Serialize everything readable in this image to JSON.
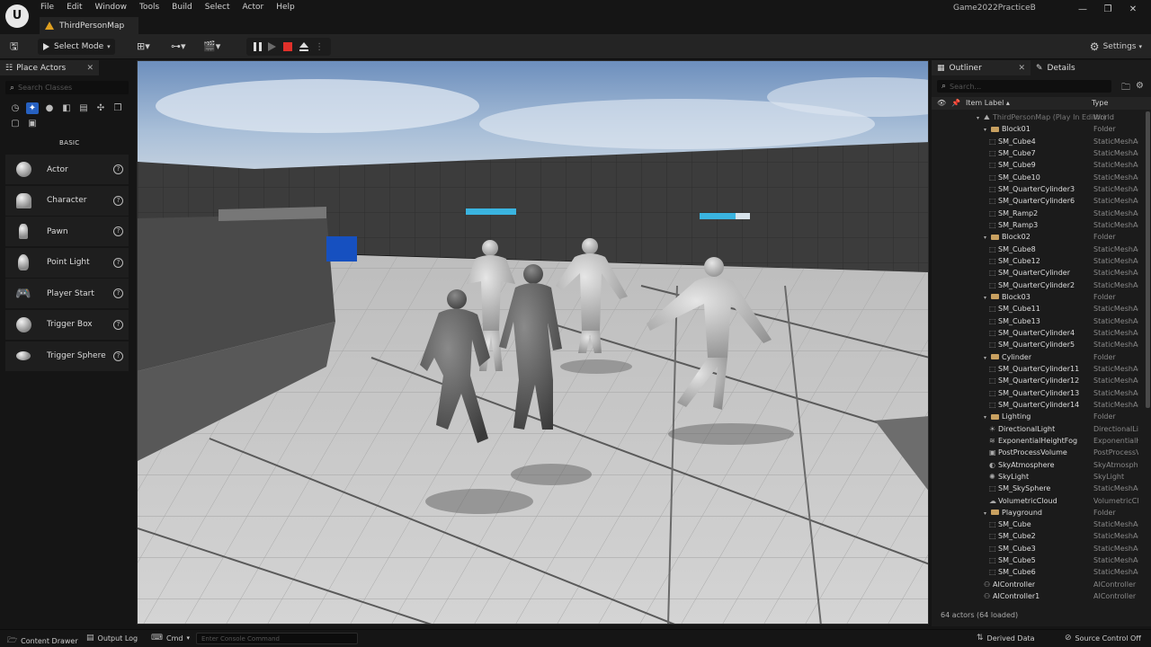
{
  "menu": [
    "File",
    "Edit",
    "Window",
    "Tools",
    "Build",
    "Select",
    "Actor",
    "Help"
  ],
  "document_tab": "ThirdPersonMap",
  "project_name": "Game2022PracticeB",
  "window_controls": [
    "—",
    "❐",
    "✕"
  ],
  "toolbar": {
    "select_mode": "Select Mode",
    "settings": "Settings"
  },
  "place_actors": {
    "tab_label": "Place Actors",
    "search_placeholder": "Search Classes",
    "category_label": "BASIC",
    "items": [
      {
        "label": "Actor"
      },
      {
        "label": "Character"
      },
      {
        "label": "Pawn"
      },
      {
        "label": "Point Light"
      },
      {
        "label": "Player Start"
      },
      {
        "label": "Trigger Box"
      },
      {
        "label": "Trigger Sphere"
      }
    ]
  },
  "outliner": {
    "tab_label": "Outliner",
    "details_tab": "Details",
    "search_placeholder": "Search...",
    "col_label": "Item Label ▴",
    "col_type": "Type",
    "footer": "64 actors (64 loaded)",
    "rows": [
      {
        "name": "ThirdPersonMap (Play In Editor)",
        "type": "World",
        "level": 0,
        "kind": "root"
      },
      {
        "name": "Block01",
        "type": "Folder",
        "level": 1,
        "kind": "folder"
      },
      {
        "name": "SM_Cube4",
        "type": "StaticMeshActor",
        "level": 2,
        "kind": "mesh"
      },
      {
        "name": "SM_Cube7",
        "type": "StaticMeshActor",
        "level": 2,
        "kind": "mesh"
      },
      {
        "name": "SM_Cube9",
        "type": "StaticMeshActor",
        "level": 2,
        "kind": "mesh"
      },
      {
        "name": "SM_Cube10",
        "type": "StaticMeshActor",
        "level": 2,
        "kind": "mesh"
      },
      {
        "name": "SM_QuarterCylinder3",
        "type": "StaticMeshActor",
        "level": 2,
        "kind": "mesh"
      },
      {
        "name": "SM_QuarterCylinder6",
        "type": "StaticMeshActor",
        "level": 2,
        "kind": "mesh"
      },
      {
        "name": "SM_Ramp2",
        "type": "StaticMeshActor",
        "level": 2,
        "kind": "mesh"
      },
      {
        "name": "SM_Ramp3",
        "type": "StaticMeshActor",
        "level": 2,
        "kind": "mesh"
      },
      {
        "name": "Block02",
        "type": "Folder",
        "level": 1,
        "kind": "folder"
      },
      {
        "name": "SM_Cube8",
        "type": "StaticMeshActor",
        "level": 2,
        "kind": "mesh"
      },
      {
        "name": "SM_Cube12",
        "type": "StaticMeshActor",
        "level": 2,
        "kind": "mesh"
      },
      {
        "name": "SM_QuarterCylinder",
        "type": "StaticMeshActor",
        "level": 2,
        "kind": "mesh"
      },
      {
        "name": "SM_QuarterCylinder2",
        "type": "StaticMeshActor",
        "level": 2,
        "kind": "mesh"
      },
      {
        "name": "Block03",
        "type": "Folder",
        "level": 1,
        "kind": "folder"
      },
      {
        "name": "SM_Cube11",
        "type": "StaticMeshActor",
        "level": 2,
        "kind": "mesh"
      },
      {
        "name": "SM_Cube13",
        "type": "StaticMeshActor",
        "level": 2,
        "kind": "mesh"
      },
      {
        "name": "SM_QuarterCylinder4",
        "type": "StaticMeshActor",
        "level": 2,
        "kind": "mesh"
      },
      {
        "name": "SM_QuarterCylinder5",
        "type": "StaticMeshActor",
        "level": 2,
        "kind": "mesh"
      },
      {
        "name": "Cylinder",
        "type": "Folder",
        "level": 1,
        "kind": "folder"
      },
      {
        "name": "SM_QuarterCylinder11",
        "type": "StaticMeshActor",
        "level": 2,
        "kind": "mesh"
      },
      {
        "name": "SM_QuarterCylinder12",
        "type": "StaticMeshActor",
        "level": 2,
        "kind": "mesh"
      },
      {
        "name": "SM_QuarterCylinder13",
        "type": "StaticMeshActor",
        "level": 2,
        "kind": "mesh"
      },
      {
        "name": "SM_QuarterCylinder14",
        "type": "StaticMeshActor",
        "level": 2,
        "kind": "mesh"
      },
      {
        "name": "Lighting",
        "type": "Folder",
        "level": 1,
        "kind": "folder"
      },
      {
        "name": "DirectionalLight",
        "type": "DirectionalLight",
        "level": 2,
        "kind": "light"
      },
      {
        "name": "ExponentialHeightFog",
        "type": "ExponentialHeightFog",
        "level": 2,
        "kind": "fog"
      },
      {
        "name": "PostProcessVolume",
        "type": "PostProcessVolume",
        "level": 2,
        "kind": "volume"
      },
      {
        "name": "SkyAtmosphere",
        "type": "SkyAtmosphere",
        "level": 2,
        "kind": "sky"
      },
      {
        "name": "SkyLight",
        "type": "SkyLight",
        "level": 2,
        "kind": "skylight"
      },
      {
        "name": "SM_SkySphere",
        "type": "StaticMeshActor",
        "level": 2,
        "kind": "mesh"
      },
      {
        "name": "VolumetricCloud",
        "type": "VolumetricCloud",
        "level": 2,
        "kind": "cloud"
      },
      {
        "name": "Playground",
        "type": "Folder",
        "level": 1,
        "kind": "folder"
      },
      {
        "name": "SM_Cube",
        "type": "StaticMeshActor",
        "level": 2,
        "kind": "mesh"
      },
      {
        "name": "SM_Cube2",
        "type": "StaticMeshActor",
        "level": 2,
        "kind": "mesh"
      },
      {
        "name": "SM_Cube3",
        "type": "StaticMeshActor",
        "level": 2,
        "kind": "mesh"
      },
      {
        "name": "SM_Cube5",
        "type": "StaticMeshActor",
        "level": 2,
        "kind": "mesh"
      },
      {
        "name": "SM_Cube6",
        "type": "StaticMeshActor",
        "level": 2,
        "kind": "mesh"
      },
      {
        "name": "AIController",
        "type": "AIController",
        "level": 0,
        "kind": "controller"
      },
      {
        "name": "AIController1",
        "type": "AIController",
        "level": 0,
        "kind": "controller"
      }
    ]
  },
  "statusbar": {
    "content_drawer": "Content Drawer",
    "output_log": "Output Log",
    "cmd": "Cmd",
    "console_placeholder": "Enter Console Command",
    "derived_data": "Derived Data",
    "source_control": "Source Control Off"
  },
  "colors": {
    "accent": "#2660c0",
    "stop": "#e0302a",
    "health_bar": "#3ab4e0"
  }
}
